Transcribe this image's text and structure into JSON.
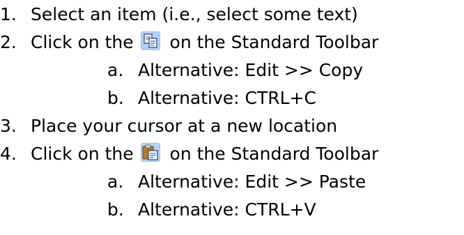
{
  "steps": [
    {
      "num": "1.",
      "text": "Select an item (i.e., select some text)"
    },
    {
      "num": "2.",
      "before": "Click on the",
      "icon": "copy-icon",
      "after": "on the Standard Toolbar",
      "alternatives": [
        {
          "num": "a.",
          "text": "Alternative: Edit >> Copy"
        },
        {
          "num": "b.",
          "text": "Alternative: CTRL+C"
        }
      ]
    },
    {
      "num": "3.",
      "text": "Place your cursor at a new location"
    },
    {
      "num": "4.",
      "before": "Click on the",
      "icon": "paste-icon",
      "after": "on the Standard Toolbar",
      "alternatives": [
        {
          "num": "a.",
          "text": "Alternative: Edit >> Paste"
        },
        {
          "num": "b.",
          "text": "Alternative: CTRL+V"
        }
      ]
    }
  ]
}
